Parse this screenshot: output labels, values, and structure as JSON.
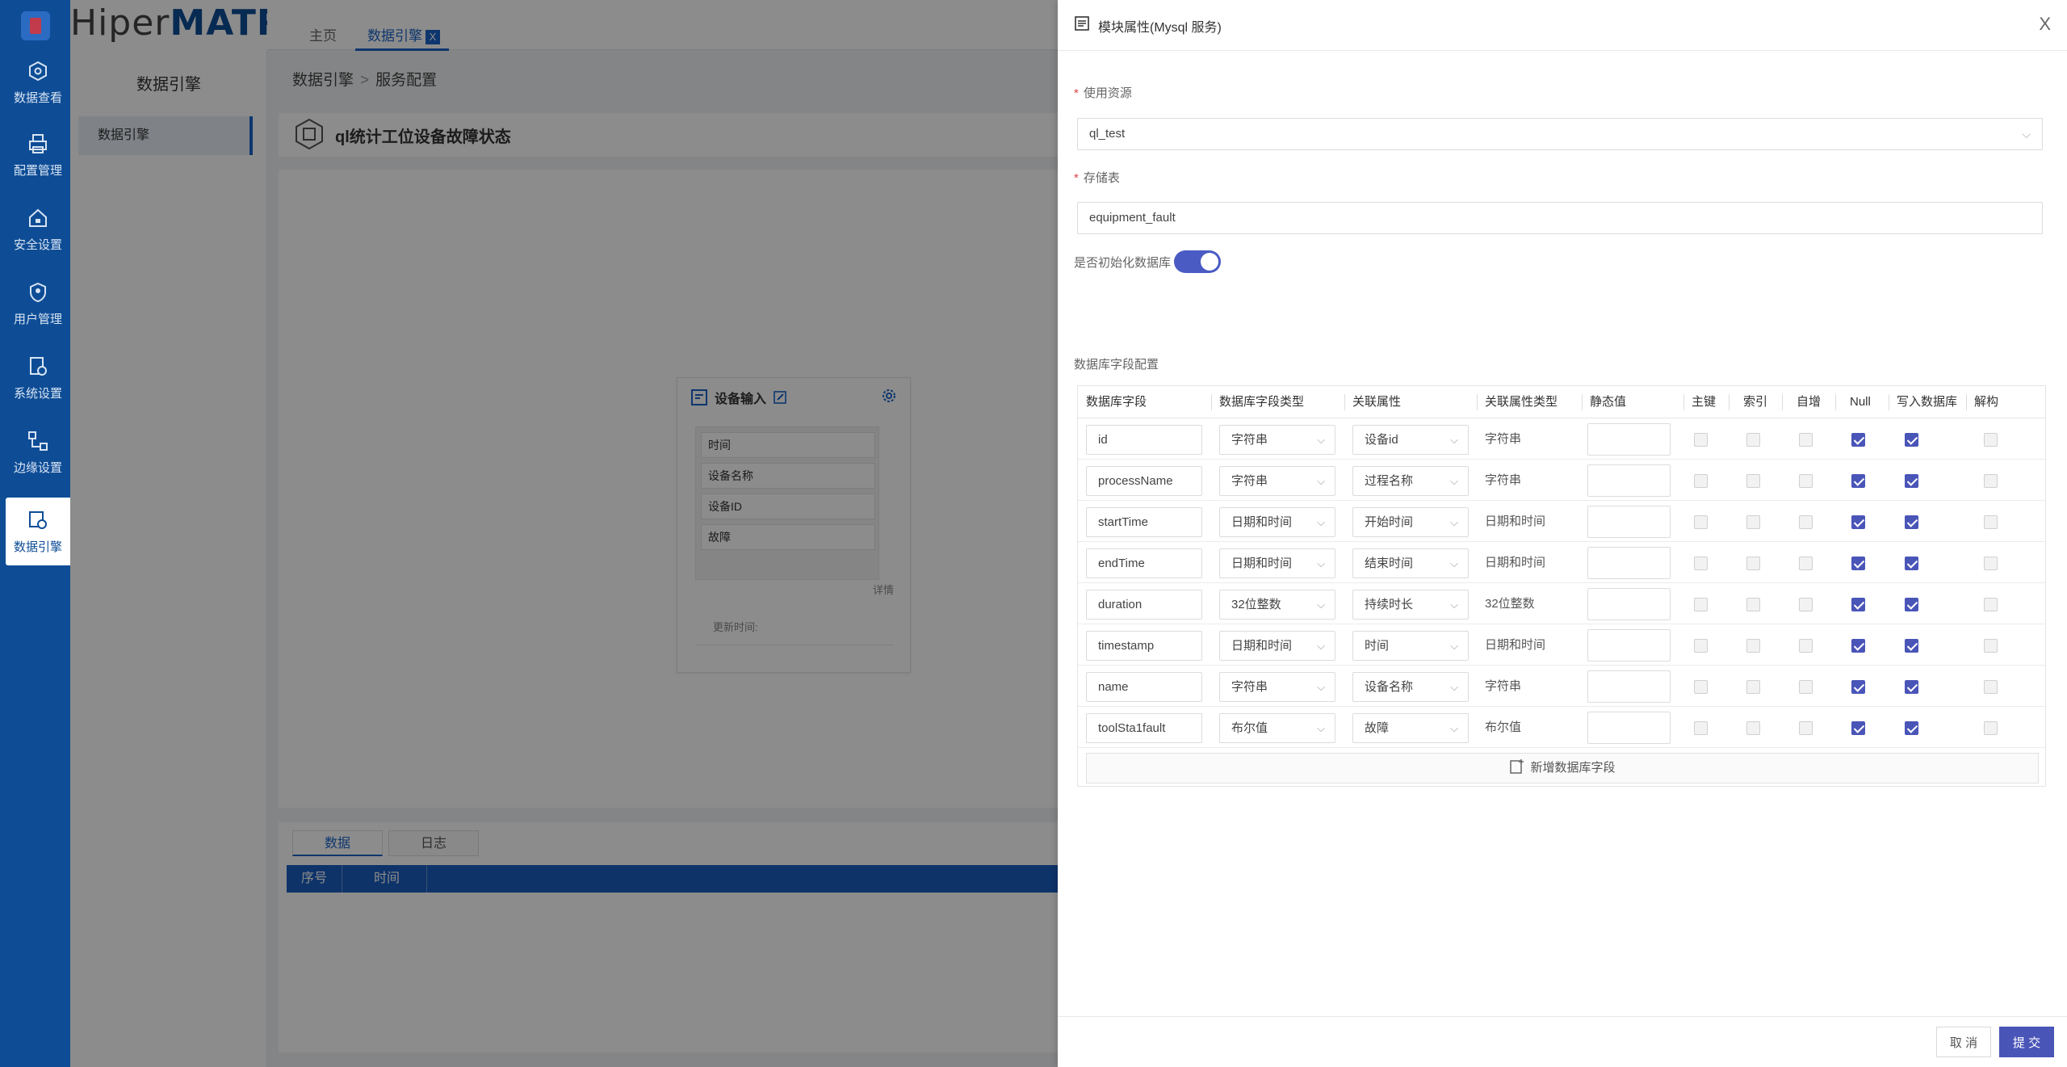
{
  "app": {
    "brand_light": "Hiper",
    "brand_bold": "MATRIX"
  },
  "nav": {
    "items": [
      {
        "label": "数据查看",
        "icon": "cube-icon"
      },
      {
        "label": "配置管理",
        "icon": "printer-icon"
      },
      {
        "label": "安全设置",
        "icon": "house-lock-icon"
      },
      {
        "label": "用户管理",
        "icon": "shield-user-icon"
      },
      {
        "label": "系统设置",
        "icon": "gear-doc-icon"
      },
      {
        "label": "边缘设置",
        "icon": "edge-nodes-icon"
      },
      {
        "label": "数据引擎",
        "icon": "engine-icon"
      }
    ]
  },
  "tabs": {
    "home": "主页",
    "engine": "数据引擎",
    "close": "X"
  },
  "subnav": {
    "title": "数据引擎",
    "item": "数据引擎"
  },
  "breadcrumb": {
    "first": "数据引擎",
    "sep": ">",
    "second": "服务配置"
  },
  "flow": {
    "title": "ql统计工位设备故障状态"
  },
  "node": {
    "title": "设备输入",
    "fields": [
      "时间",
      "设备名称",
      "设备ID",
      "故障"
    ],
    "detail": "详情",
    "update": "更新时间:"
  },
  "bottom": {
    "tabs": [
      "数据",
      "日志"
    ],
    "columns": [
      "序号",
      "时间"
    ]
  },
  "drawer": {
    "title": "模块属性(Mysql 服务)",
    "close": "X",
    "resource_label": "使用资源",
    "resource_value": "ql_test",
    "table_label": "存储表",
    "table_value": "equipment_fault",
    "init_label": "是否初始化数据库",
    "section_label": "数据库字段配置",
    "columns": [
      "数据库字段",
      "数据库字段类型",
      "关联属性",
      "关联属性类型",
      "静态值",
      "主键",
      "索引",
      "自增",
      "Null",
      "写入数据库",
      "解构"
    ],
    "rows": [
      {
        "field": "id",
        "type": "字符串",
        "attr": "设备id",
        "attr_type": "字符串",
        "null": true,
        "write": true
      },
      {
        "field": "processName",
        "type": "字符串",
        "attr": "过程名称",
        "attr_type": "字符串",
        "null": true,
        "write": true
      },
      {
        "field": "startTime",
        "type": "日期和时间",
        "attr": "开始时间",
        "attr_type": "日期和时间",
        "null": true,
        "write": true
      },
      {
        "field": "endTime",
        "type": "日期和时间",
        "attr": "结束时间",
        "attr_type": "日期和时间",
        "null": true,
        "write": true
      },
      {
        "field": "duration",
        "type": "32位整数",
        "attr": "持续时长",
        "attr_type": "32位整数",
        "null": true,
        "write": true
      },
      {
        "field": "timestamp",
        "type": "日期和时间",
        "attr": "时间",
        "attr_type": "日期和时间",
        "null": true,
        "write": true
      },
      {
        "field": "name",
        "type": "字符串",
        "attr": "设备名称",
        "attr_type": "字符串",
        "null": true,
        "write": true
      },
      {
        "field": "toolSta1fault",
        "type": "布尔值",
        "attr": "故障",
        "attr_type": "布尔值",
        "null": true,
        "write": true
      }
    ],
    "add_label": "新增数据库字段",
    "cancel": "取 消",
    "submit": "提 交"
  },
  "colors": {
    "primary": "#1a63c9",
    "nav_bg": "#0e4d96",
    "accent": "#4a55b8"
  }
}
